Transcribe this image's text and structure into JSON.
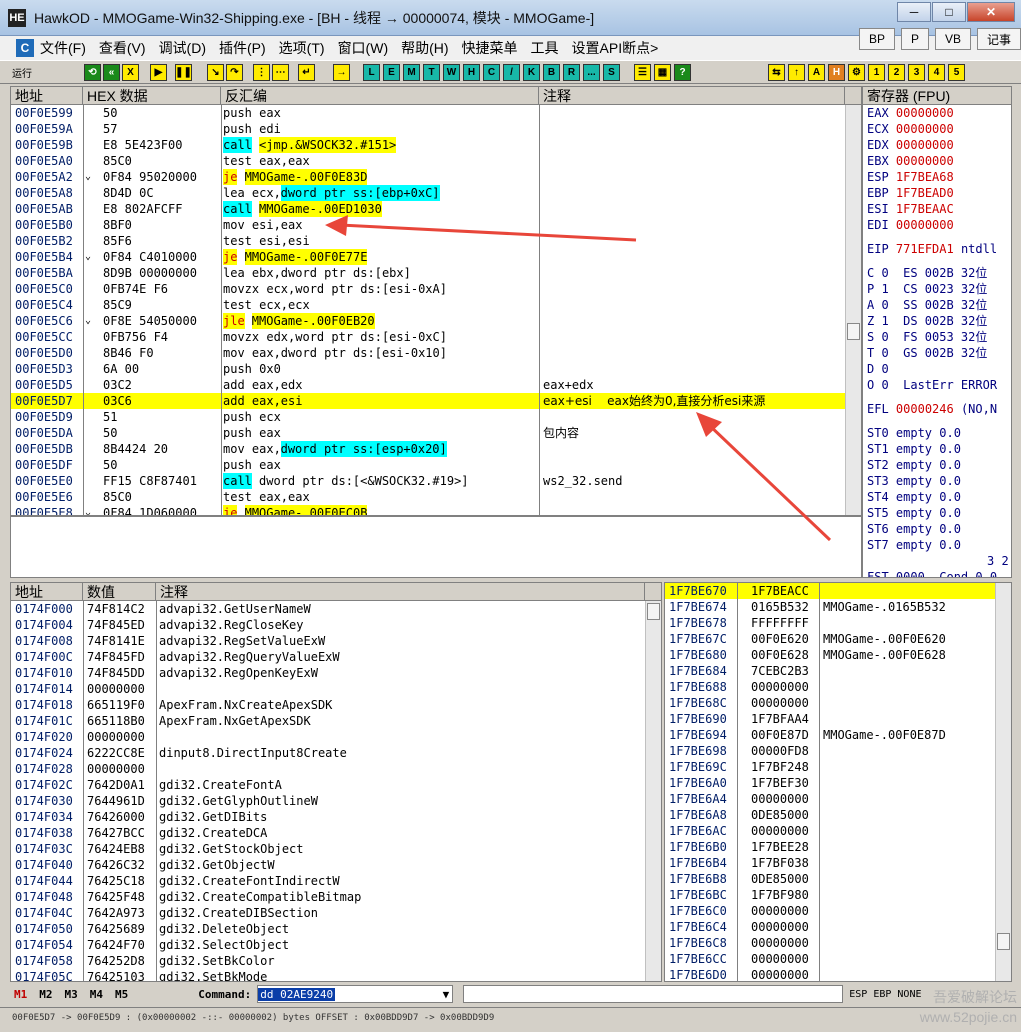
{
  "window": {
    "title": "HawkOD - MMOGame-Win32-Shipping.exe - [BH - 线程 → 00000074, 模块 - MMOGame-]",
    "app_icon": "HE",
    "min": "─",
    "max": "□",
    "close": "✕"
  },
  "menu": {
    "logo": "C",
    "items": [
      "文件(F)",
      "查看(V)",
      "调试(D)",
      "插件(P)",
      "选项(T)",
      "窗口(W)",
      "帮助(H)",
      "快捷菜单",
      "工具",
      "设置API断点>"
    ]
  },
  "side_buttons": [
    "BP",
    "P",
    "VB",
    "记事"
  ],
  "toolbar": {
    "run_label": "运行",
    "letters": [
      "L",
      "E",
      "M",
      "T",
      "W",
      "H",
      "C",
      "/",
      "K",
      "B",
      "R",
      "...",
      "S"
    ],
    "nums": [
      "1",
      "2",
      "3",
      "4",
      "5"
    ]
  },
  "disasm": {
    "headers": [
      "地址",
      "HEX 数据",
      "反汇编",
      "注释"
    ],
    "rows": [
      {
        "addr": "00F0E599",
        "hex": "50",
        "asm": "push eax",
        "comment": ""
      },
      {
        "addr": "00F0E59A",
        "hex": "57",
        "asm": "push edi",
        "comment": ""
      },
      {
        "addr": "00F0E59B",
        "hex": "E8 5E423F00",
        "asm_kw": "call",
        "asm_arg": "<jmp.&WSOCK32.#151>",
        "comment": ""
      },
      {
        "addr": "00F0E5A0",
        "hex": "85C0",
        "asm": "test eax,eax",
        "comment": ""
      },
      {
        "addr": "00F0E5A2",
        "hex": "0F84 95020000",
        "asm_kw": "je",
        "asm_arg": "MMOGame-.00F0E83D",
        "comment": ""
      },
      {
        "addr": "00F0E5A8",
        "hex": "8D4D 0C",
        "asm": "lea ecx,",
        "asm_arg2": "dword ptr ss:[ebp+0xC]",
        "comment": ""
      },
      {
        "addr": "00F0E5AB",
        "hex": "E8 802AFCFF",
        "asm_kw": "call",
        "asm_arg": "MMOGame-.00ED1030",
        "comment": ""
      },
      {
        "addr": "00F0E5B0",
        "hex": "8BF0",
        "asm": "mov esi,eax",
        "comment": ""
      },
      {
        "addr": "00F0E5B2",
        "hex": "85F6",
        "asm": "test esi,esi",
        "comment": ""
      },
      {
        "addr": "00F0E5B4",
        "hex": "0F84 C4010000",
        "asm_kw": "je",
        "asm_arg": "MMOGame-.00F0E77E",
        "comment": ""
      },
      {
        "addr": "00F0E5BA",
        "hex": "8D9B 00000000",
        "asm": "lea ebx,dword ptr ds:[ebx]",
        "comment": ""
      },
      {
        "addr": "00F0E5C0",
        "hex": "0FB74E F6",
        "asm": "movzx ecx,word ptr ds:[esi-0xA]",
        "comment": ""
      },
      {
        "addr": "00F0E5C4",
        "hex": "85C9",
        "asm": "test ecx,ecx",
        "comment": ""
      },
      {
        "addr": "00F0E5C6",
        "hex": "0F8E 54050000",
        "asm_kw": "jle",
        "asm_arg": "MMOGame-.00F0EB20",
        "comment": ""
      },
      {
        "addr": "00F0E5CC",
        "hex": "0FB756 F4",
        "asm": "movzx edx,word ptr ds:[esi-0xC]",
        "comment": ""
      },
      {
        "addr": "00F0E5D0",
        "hex": "8B46 F0",
        "asm": "mov eax,dword ptr ds:[esi-0x10]",
        "comment": ""
      },
      {
        "addr": "00F0E5D3",
        "hex": "6A 00",
        "asm": "push 0x0",
        "comment": ""
      },
      {
        "addr": "00F0E5D5",
        "hex": "03C2",
        "asm": "add eax,edx",
        "comment": "eax+edx"
      },
      {
        "addr": "00F0E5D7",
        "hex": "03C6",
        "asm": "add eax,esi",
        "comment": "eax+esi    eax始终为0,直接分析esi来源"
      },
      {
        "addr": "00F0E5D9",
        "hex": "51",
        "asm": "push ecx",
        "comment": ""
      },
      {
        "addr": "00F0E5DA",
        "hex": "50",
        "asm": "push eax",
        "comment": "包内容"
      },
      {
        "addr": "00F0E5DB",
        "hex": "8B4424 20",
        "asm": "mov eax,",
        "asm_arg2": "dword ptr ss:[esp+0x20]",
        "comment": ""
      },
      {
        "addr": "00F0E5DF",
        "hex": "50",
        "asm": "push eax",
        "comment": ""
      },
      {
        "addr": "00F0E5E0",
        "hex": "FF15 C8F87401",
        "asm_kw": "call",
        "asm_plain": "dword ptr ds:[<&WSOCK32.#19>]",
        "comment": "ws2_32.send"
      },
      {
        "addr": "00F0E5E6",
        "hex": "85C0",
        "asm": "test eax,eax",
        "comment": ""
      },
      {
        "addr": "00F0E5E8",
        "hex": "0F84 1D060000",
        "asm_kw": "je",
        "asm_arg": "MMOGame-.00F0EC0B",
        "comment": ""
      }
    ]
  },
  "registers": {
    "header": "寄存器 (FPU)",
    "regs": [
      {
        "name": "EAX",
        "val": "00000000",
        "extra": ""
      },
      {
        "name": "ECX",
        "val": "00000000",
        "extra": ""
      },
      {
        "name": "EDX",
        "val": "00000000",
        "extra": ""
      },
      {
        "name": "EBX",
        "val": "00000000",
        "extra": ""
      },
      {
        "name": "ESP",
        "val": "1F7BEA68",
        "extra": ""
      },
      {
        "name": "EBP",
        "val": "1F7BEAD0",
        "extra": ""
      },
      {
        "name": "ESI",
        "val": "1F7BEAAC",
        "extra": ""
      },
      {
        "name": "EDI",
        "val": "00000000",
        "extra": ""
      }
    ],
    "eip": {
      "name": "EIP",
      "val": "771EFDA1",
      "extra": "ntdll"
    },
    "flags": [
      "C 0  ES 002B 32位",
      "P 1  CS 0023 32位",
      "A 0  SS 002B 32位",
      "Z 1  DS 002B 32位",
      "S 0  FS 0053 32位",
      "T 0  GS 002B 32位",
      "D 0",
      "O 0  LastErr ERROR"
    ],
    "efl": {
      "name": "EFL",
      "val": "00000246",
      "extra": "(NO,N"
    },
    "fpu": [
      "ST0 empty 0.0",
      "ST1 empty 0.0",
      "ST2 empty 0.0",
      "ST3 empty 0.0",
      "ST4 empty 0.0",
      "ST5 empty 0.0",
      "ST6 empty 0.0",
      "ST7 empty 0.0"
    ],
    "tail1": "3 2",
    "tail2": "FST 0000  Cond 0 0"
  },
  "dump": {
    "headers": [
      "地址",
      "数值",
      "注释"
    ],
    "rows": [
      [
        "0174F000",
        "74F814C2",
        "advapi32.GetUserNameW"
      ],
      [
        "0174F004",
        "74F845ED",
        "advapi32.RegCloseKey"
      ],
      [
        "0174F008",
        "74F8141E",
        "advapi32.RegSetValueExW"
      ],
      [
        "0174F00C",
        "74F845FD",
        "advapi32.RegQueryValueExW"
      ],
      [
        "0174F010",
        "74F845DD",
        "advapi32.RegOpenKeyExW"
      ],
      [
        "0174F014",
        "00000000",
        ""
      ],
      [
        "0174F018",
        "665119F0",
        "ApexFram.NxCreateApexSDK"
      ],
      [
        "0174F01C",
        "665118B0",
        "ApexFram.NxGetApexSDK"
      ],
      [
        "0174F020",
        "00000000",
        ""
      ],
      [
        "0174F024",
        "6222CC8E",
        "dinput8.DirectInput8Create"
      ],
      [
        "0174F028",
        "00000000",
        ""
      ],
      [
        "0174F02C",
        "7642D0A1",
        "gdi32.CreateFontA"
      ],
      [
        "0174F030",
        "7644961D",
        "gdi32.GetGlyphOutlineW"
      ],
      [
        "0174F034",
        "76426000",
        "gdi32.GetDIBits"
      ],
      [
        "0174F038",
        "76427BCC",
        "gdi32.CreateDCA"
      ],
      [
        "0174F03C",
        "76424EB8",
        "gdi32.GetStockObject"
      ],
      [
        "0174F040",
        "76426C32",
        "gdi32.GetObjectW"
      ],
      [
        "0174F044",
        "76425C18",
        "gdi32.CreateFontIndirectW"
      ],
      [
        "0174F048",
        "76425F48",
        "gdi32.CreateCompatibleBitmap"
      ],
      [
        "0174F04C",
        "7642A973",
        "gdi32.CreateDIBSection"
      ],
      [
        "0174F050",
        "76425689",
        "gdi32.DeleteObject"
      ],
      [
        "0174F054",
        "76424F70",
        "gdi32.SelectObject"
      ],
      [
        "0174F058",
        "764252D8",
        "gdi32.SetBkColor"
      ],
      [
        "0174F05C",
        "76425103",
        "gdi32.SetBkMode"
      ]
    ]
  },
  "stack": {
    "rows": [
      [
        "1F7BE670",
        "1F7BEACC",
        ""
      ],
      [
        "1F7BE674",
        "0165B532",
        "MMOGame-.0165B532"
      ],
      [
        "1F7BE678",
        "FFFFFFFF",
        ""
      ],
      [
        "1F7BE67C",
        "00F0E620",
        "MMOGame-.00F0E620"
      ],
      [
        "1F7BE680",
        "00F0E628",
        "MMOGame-.00F0E628"
      ],
      [
        "1F7BE684",
        "7CEBC2B3",
        ""
      ],
      [
        "1F7BE688",
        "00000000",
        ""
      ],
      [
        "1F7BE68C",
        "00000000",
        ""
      ],
      [
        "1F7BE690",
        "1F7BFAA4",
        ""
      ],
      [
        "1F7BE694",
        "00F0E87D",
        "MMOGame-.00F0E87D"
      ],
      [
        "1F7BE698",
        "00000FD8",
        ""
      ],
      [
        "1F7BE69C",
        "1F7BF248",
        ""
      ],
      [
        "1F7BE6A0",
        "1F7BEF30",
        ""
      ],
      [
        "1F7BE6A4",
        "00000000",
        ""
      ],
      [
        "1F7BE6A8",
        "0DE85000",
        ""
      ],
      [
        "1F7BE6AC",
        "00000000",
        ""
      ],
      [
        "1F7BE6B0",
        "1F7BEE28",
        ""
      ],
      [
        "1F7BE6B4",
        "1F7BF038",
        ""
      ],
      [
        "1F7BE6B8",
        "0DE85000",
        ""
      ],
      [
        "1F7BE6BC",
        "1F7BF980",
        ""
      ],
      [
        "1F7BE6C0",
        "00000000",
        ""
      ],
      [
        "1F7BE6C4",
        "00000000",
        ""
      ],
      [
        "1F7BE6C8",
        "00000000",
        ""
      ],
      [
        "1F7BE6CC",
        "00000000",
        ""
      ],
      [
        "1F7BE6D0",
        "00000000",
        ""
      ]
    ]
  },
  "command": {
    "tabs": [
      "M1",
      "M2",
      "M3",
      "M4",
      "M5"
    ],
    "label": "Command:",
    "value": "dd 02AE9240",
    "right": "ESP EBP NONE"
  },
  "status": {
    "text": "00F0E5D7 -> 00F0E5D9 : (0x00000002 -::- 00000002) bytes      OFFSET : 0x00BDD9D7 -> 0x00BDD9D9"
  },
  "watermark": {
    "line1": "吾爱破解论坛",
    "line2": "www.52pojie.cn"
  },
  "colors": {
    "highlight": "#ffff00",
    "cyan": "#00ffff",
    "arrow": "#e8463a",
    "addr": "#001d66"
  }
}
